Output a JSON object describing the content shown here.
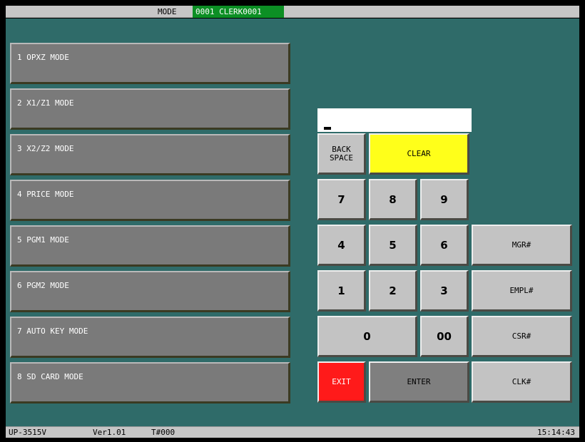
{
  "header": {
    "mode_label": "MODE",
    "clerk": "0001 CLERK0001"
  },
  "mode_buttons": [
    "1 OPXZ MODE",
    "2 X1/Z1 MODE",
    "3 X2/Z2 MODE",
    "4 PRICE MODE",
    "5 PGM1 MODE",
    "6 PGM2 MODE",
    "7 AUTO KEY MODE",
    "8 SD CARD MODE"
  ],
  "entry": {
    "value": ""
  },
  "keypad": {
    "backspace_line1": "BACK",
    "backspace_line2": "SPACE",
    "clear": "CLEAR",
    "k7": "7",
    "k8": "8",
    "k9": "9",
    "k4": "4",
    "k5": "5",
    "k6": "6",
    "k1": "1",
    "k2": "2",
    "k3": "3",
    "k0": "0",
    "k00": "00",
    "exit": "EXIT",
    "enter": "ENTER",
    "mgr": "MGR#",
    "empl": "EMPL#",
    "csr": "CSR#",
    "clk": "CLK#"
  },
  "status": {
    "model": "UP-3515V",
    "version": "Ver1.01",
    "terminal": "T#000",
    "time": "15:14:43"
  },
  "colors": {
    "background": "#2f6b69",
    "clear_key": "#ffff1a",
    "exit_key": "#ff1a1a",
    "clerk_badge": "#0c8f24"
  }
}
